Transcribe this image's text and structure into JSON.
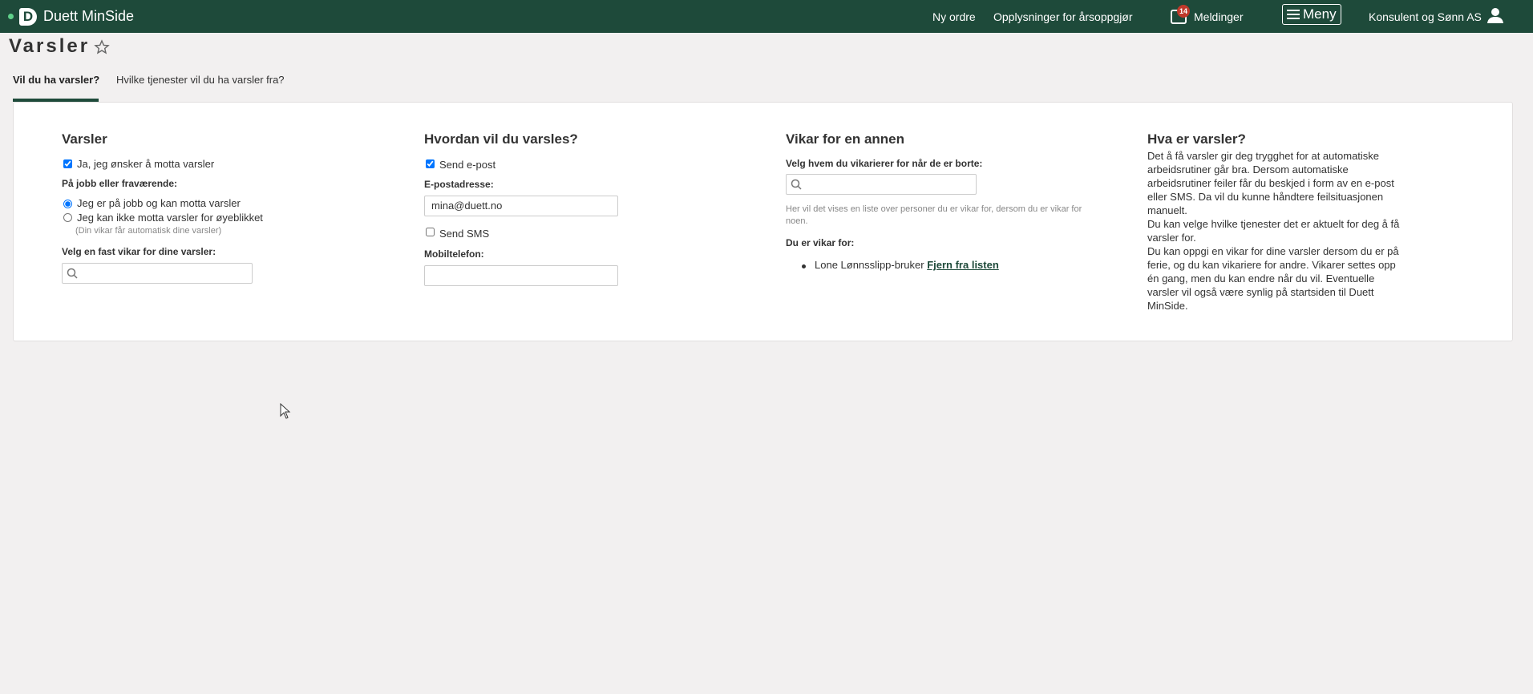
{
  "header": {
    "brand": "Duett MinSide",
    "nav_new_order": "Ny ordre",
    "nav_year_info": "Opplysninger for årsoppgjør",
    "messages_label": "Meldinger",
    "messages_count": "14",
    "menu_label": "Meny",
    "company": "Konsulent og Sønn AS"
  },
  "page": {
    "title": "Varsler"
  },
  "tabs": [
    {
      "label": "Vil du ha varsler?"
    },
    {
      "label": "Hvilke tjenester vil du ha varsler fra?"
    }
  ],
  "col_varsler": {
    "title": "Varsler",
    "opt_in_label": "Ja, jeg ønsker å motta varsler",
    "presence_label": "På jobb eller fraværende:",
    "radio_at_work": "Jeg er på jobb og kan motta varsler",
    "radio_away": "Jeg kan ikke motta varsler for øyeblikket",
    "away_hint": "(Din vikar får automatisk dine varsler)",
    "substitute_label": "Velg en fast vikar for dine varsler:"
  },
  "col_how": {
    "title": "Hvordan vil du varsles?",
    "email_checkbox": "Send e-post",
    "email_label": "E-postadresse:",
    "email_value": "mina@duett.no",
    "sms_checkbox": "Send SMS",
    "phone_label": "Mobiltelefon:",
    "phone_value": ""
  },
  "col_substitute": {
    "title": "Vikar for en annen",
    "select_label": "Velg hvem du vikarierer for når de er borte:",
    "hint": "Her vil det vises en liste over personer du er vikar for, dersom du er vikar for noen.",
    "you_are_sub_label": "Du er vikar for:",
    "person": "Lone Lønnsslipp-bruker",
    "remove_link": "Fjern fra listen"
  },
  "col_info": {
    "title": "Hva er varsler?",
    "text": "Det å få varsler gir deg trygghet for at automatiske arbeidsrutiner går bra. Dersom automatiske arbeidsrutiner feiler får du beskjed i form av en e-post eller SMS. Da vil du kunne håndtere feilsituasjonen manuelt.",
    "text2": "Du kan velge hvilke tjenester det er aktuelt for deg å få varsler for.",
    "text3": "Du kan oppgi en vikar for dine varsler dersom du er på ferie, og du kan vikariere for andre. Vikarer settes opp én gang, men du kan endre når du vil. Eventuelle varsler vil også være synlig på startsiden til Duett MinSide."
  }
}
